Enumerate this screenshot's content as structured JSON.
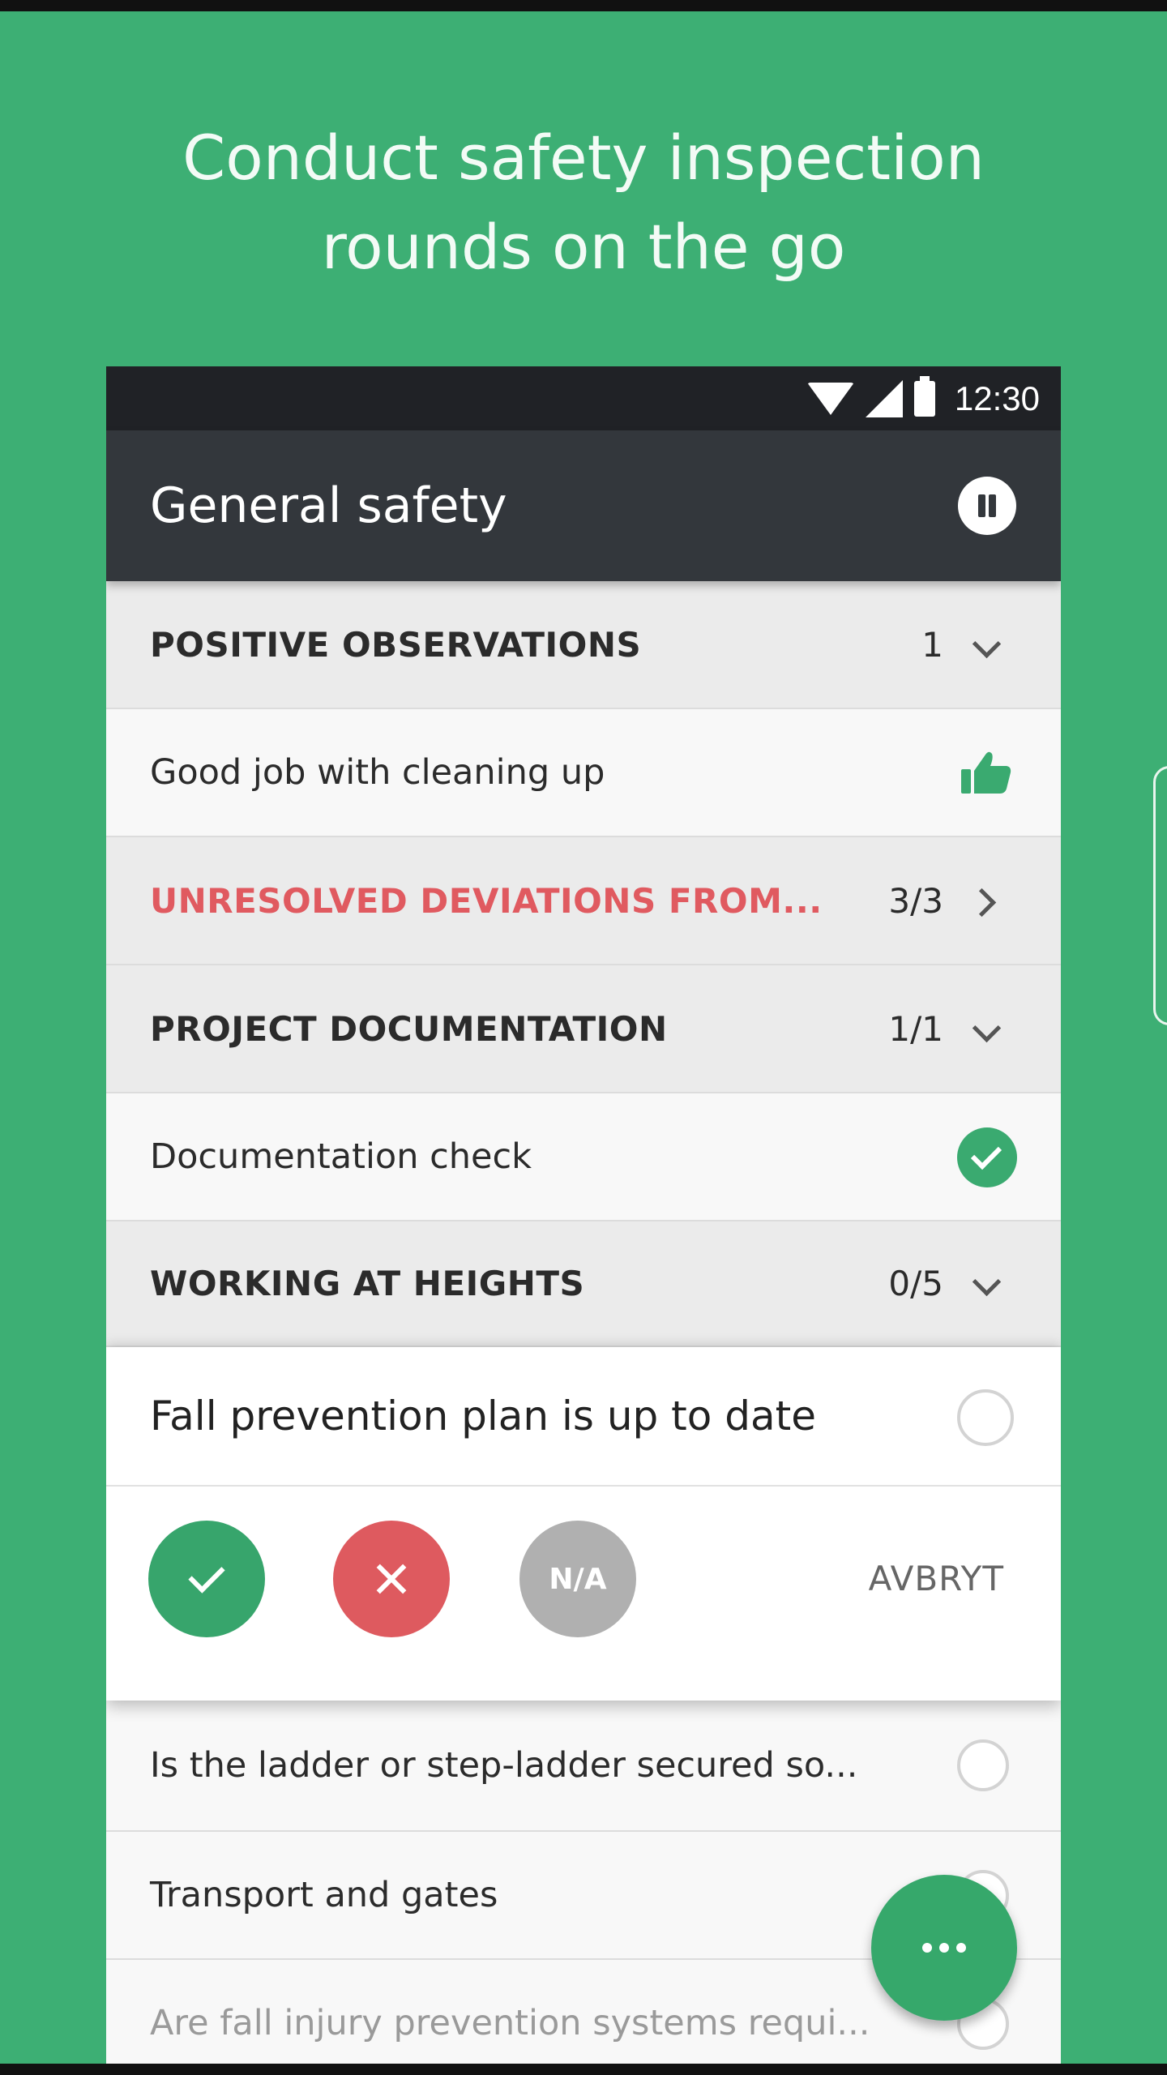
{
  "headline": {
    "line1": "Conduct safety inspection",
    "line2": "rounds on the go"
  },
  "status_bar": {
    "time": "12:30",
    "icons": [
      "wifi-icon",
      "signal-icon",
      "battery-icon"
    ]
  },
  "app_bar": {
    "title": "General safety",
    "action_icon": "pause-icon"
  },
  "sections": [
    {
      "label": "POSITIVE OBSERVATIONS",
      "count": "1",
      "indicator": "chevron-down-icon"
    },
    {
      "label": "UNRESOLVED DEVIATIONS FROM...",
      "count": "3/3",
      "indicator": "chevron-right-icon",
      "color": "#e05a60"
    },
    {
      "label": "PROJECT DOCUMENTATION",
      "count": "1/1",
      "indicator": "chevron-down-icon"
    },
    {
      "label": "WORKING AT HEIGHTS",
      "count": "0/5",
      "indicator": "chevron-down-icon"
    }
  ],
  "items": {
    "positive_observation": {
      "label": "Good job with cleaning up",
      "icon": "thumbs-up-icon"
    },
    "documentation_check": {
      "label": "Documentation check",
      "icon": "check-circle-icon"
    }
  },
  "expanded_question": {
    "label": "Fall prevention plan is up to date",
    "buttons": {
      "ok_icon": "check-icon",
      "fail_icon": "close-icon",
      "na_label": "N/A"
    },
    "cancel_label": "AVBRYT"
  },
  "questions": [
    {
      "label": "Is the ladder or step-ladder secured so..."
    },
    {
      "label": "Transport and gates"
    },
    {
      "label": "Are fall injury prevention systems requi..."
    }
  ],
  "fab": {
    "icon": "more-icon"
  },
  "colors": {
    "background": "#3daf74",
    "app_bar": "#33373c",
    "accent_green": "#37a56c",
    "accent_red": "#de5a5f",
    "neutral_gray": "#b0b0b0"
  }
}
